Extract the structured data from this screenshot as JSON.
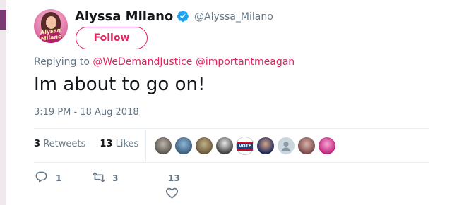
{
  "user": {
    "display_name": "Alyssa Milano",
    "handle": "@Alyssa_Milano",
    "avatar_text": "Alyssa Milano"
  },
  "follow_label": "Follow",
  "reply": {
    "prefix": "Replying to",
    "mentions": [
      "@WeDemandJustice",
      "@importantmeagan"
    ]
  },
  "tweet": {
    "text": "Im about to go on!",
    "timestamp": "3:19 PM - 18 Aug 2018"
  },
  "stats": {
    "retweets_count": "3",
    "retweets_label": "Retweets",
    "likes_count": "13",
    "likes_label": "Likes"
  },
  "actions": {
    "reply_count": "1",
    "retweet_count": "3",
    "like_count": "13"
  },
  "colors": {
    "accent": "#e0245e",
    "verified": "#1da1f2",
    "muted": "#657786"
  },
  "liker_avatars": [
    {
      "icon": "user-avatar"
    },
    {
      "icon": "user-avatar"
    },
    {
      "icon": "user-avatar"
    },
    {
      "icon": "user-avatar"
    },
    {
      "icon": "vote-avatar",
      "text": "VOTE"
    },
    {
      "icon": "user-avatar"
    },
    {
      "icon": "default-avatar"
    },
    {
      "icon": "user-avatar"
    },
    {
      "icon": "user-avatar"
    }
  ]
}
